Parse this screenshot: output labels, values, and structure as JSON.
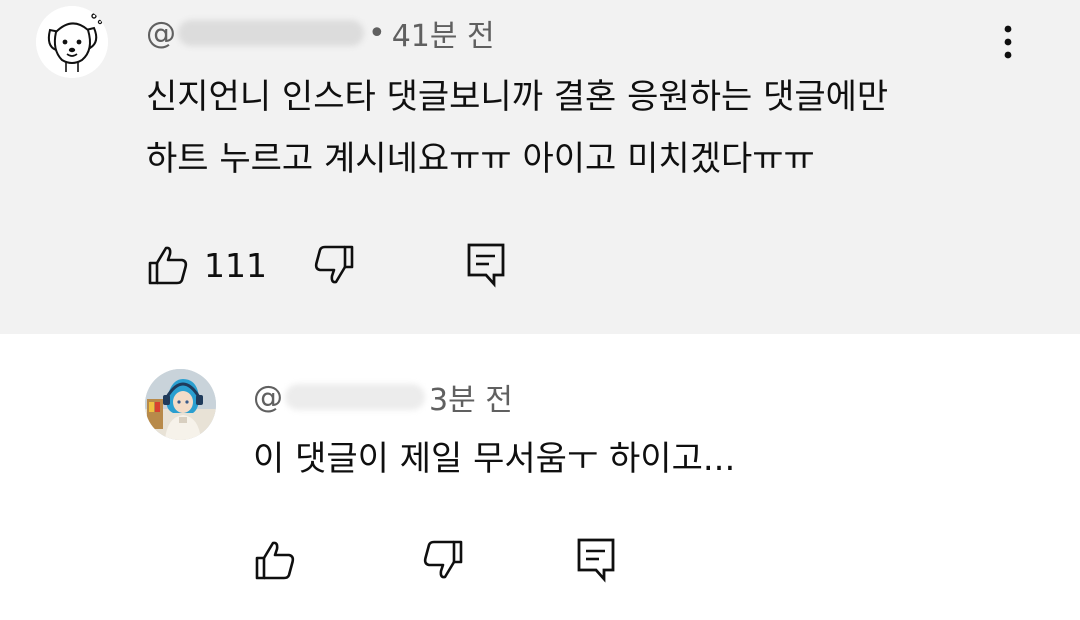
{
  "comments": [
    {
      "handle_prefix": "@",
      "separator": "•",
      "time": "41분 전",
      "lines": [
        "신지언니 인스타 댓글보니까 결혼 응원하는 댓글에만",
        "하트 누르고 계시네요ㅠㅠ 아이고 미치겠다ㅠㅠ"
      ],
      "like_count": "111",
      "icons": {
        "avatar": "dog-cartoon-avatar",
        "menu": "more-vert-icon",
        "like": "thumbs-up-icon",
        "dislike": "thumbs-down-icon",
        "reply": "reply-comment-icon"
      }
    },
    {
      "handle_prefix": "@",
      "time": "3분 전",
      "lines": [
        "이 댓글이 제일 무서움ㅜ 하이고..."
      ],
      "icons": {
        "avatar": "anime-character-avatar",
        "like": "thumbs-up-icon",
        "dislike": "thumbs-down-icon",
        "reply": "reply-comment-icon"
      }
    }
  ],
  "colors": {
    "main_background": "#f2f2f2",
    "reply_background": "#ffffff",
    "meta_text": "#606060",
    "body_text": "#0f0f0f"
  }
}
